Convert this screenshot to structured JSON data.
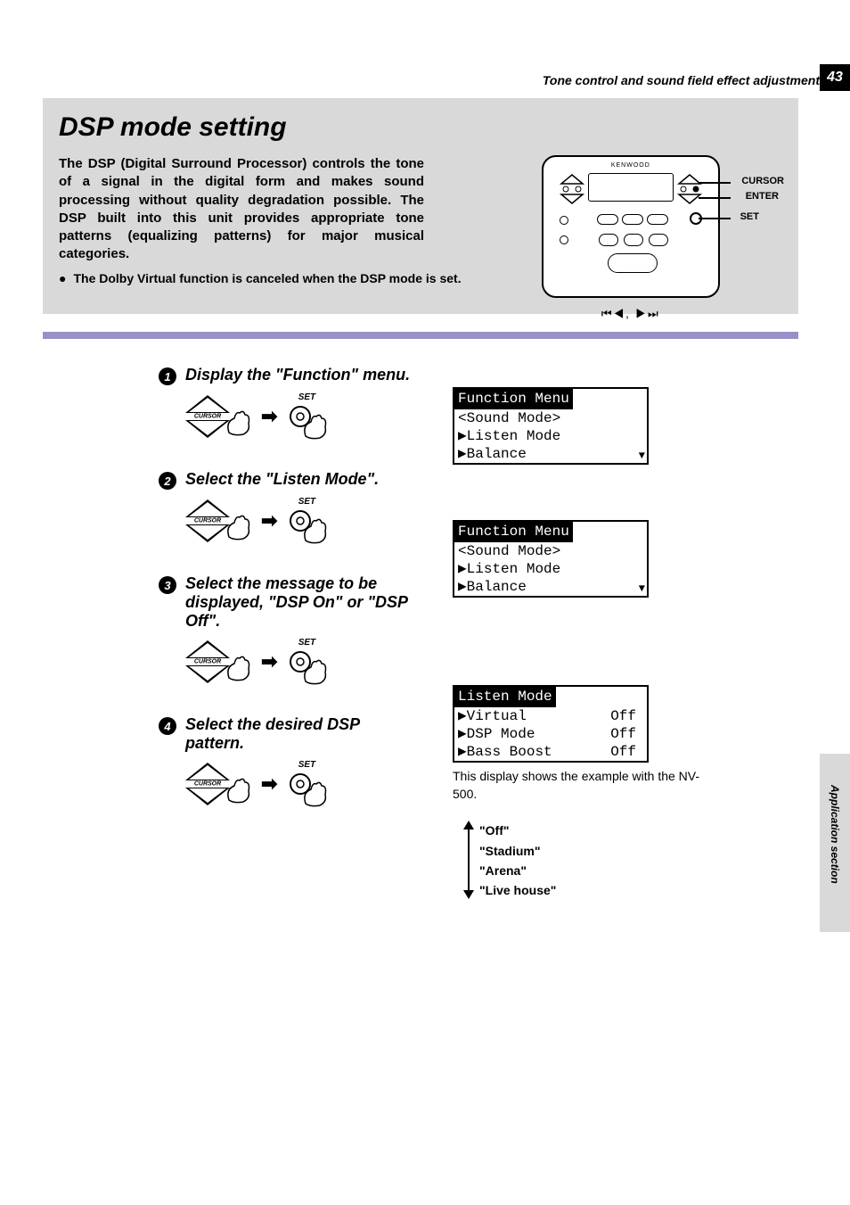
{
  "page_number": "43",
  "header_section": "Tone control and sound field effect adjustment",
  "title": "DSP mode setting",
  "intro": "The DSP (Digital Surround Processor) controls the tone of a signal in the digital form and makes sound processing without quality degradation possible. The DSP built into this unit provides appropriate tone patterns (equalizing patterns) for major musical categories.",
  "note": "The Dolby Virtual function is canceled when the DSP mode is set.",
  "remote": {
    "brand": "KENWOOD",
    "callout_cursor": "CURSOR",
    "callout_enter": "ENTER",
    "callout_set": "SET"
  },
  "steps": {
    "s1": {
      "title": "Display the \"Function\" menu."
    },
    "s2": {
      "title": "Select the \"Listen Mode\"."
    },
    "s3": {
      "title": "Select the message to be displayed, \"DSP On\" or \"DSP Off\"."
    },
    "s4": {
      "title": "Select the desired DSP pattern."
    }
  },
  "cursor_label": "CURSOR",
  "set_label": "SET",
  "lcd1": {
    "title": "Function Menu",
    "row1": "<Sound Mode>",
    "row2": "▶Listen Mode",
    "row3": "▶Balance"
  },
  "lcd2": {
    "title": "Function Menu",
    "row1": "<Sound Mode>",
    "row2": "▶Listen Mode",
    "row3": "▶Balance"
  },
  "lcd3": {
    "title": "Listen Mode",
    "rows": [
      {
        "label": "▶Virtual",
        "val": "Off"
      },
      {
        "label": "▶DSP Mode",
        "val": "Off"
      },
      {
        "label": "▶Bass Boost",
        "val": "Off"
      }
    ]
  },
  "caption": "This display shows the example with the NV-500.",
  "options": {
    "o1": "\"Off\"",
    "o2": "\"Stadium\"",
    "o3": "\"Arena\"",
    "o4": "\"Live house\""
  },
  "side_section": "Application section"
}
